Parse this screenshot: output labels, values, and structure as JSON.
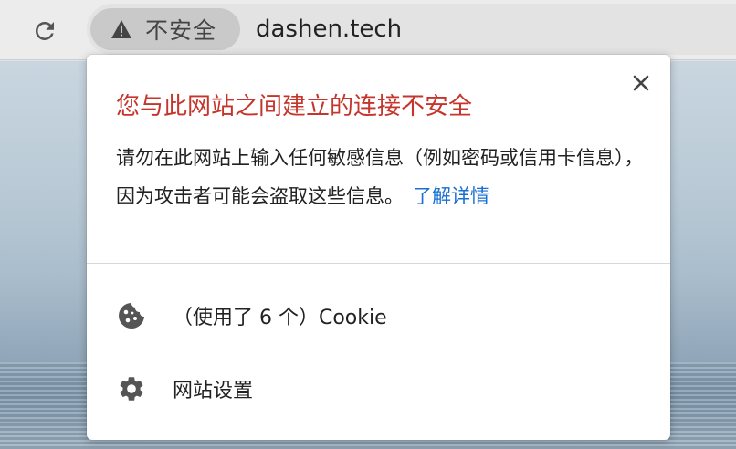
{
  "browser": {
    "security_chip_label": "不安全",
    "url": "dashen.tech"
  },
  "popup": {
    "title": "您与此网站之间建立的连接不安全",
    "description": "请勿在此网站上输入任何敏感信息（例如密码或信用卡信息），因为攻击者可能会盗取这些信息。",
    "learn_more": "了解详情",
    "rows": [
      {
        "icon": "cookie-icon",
        "label": "（使用了 6 个）Cookie"
      },
      {
        "icon": "gear-icon",
        "label": "网站设置"
      }
    ]
  },
  "colors": {
    "title_red": "#c5352b",
    "link_blue": "#1a6fd0"
  }
}
